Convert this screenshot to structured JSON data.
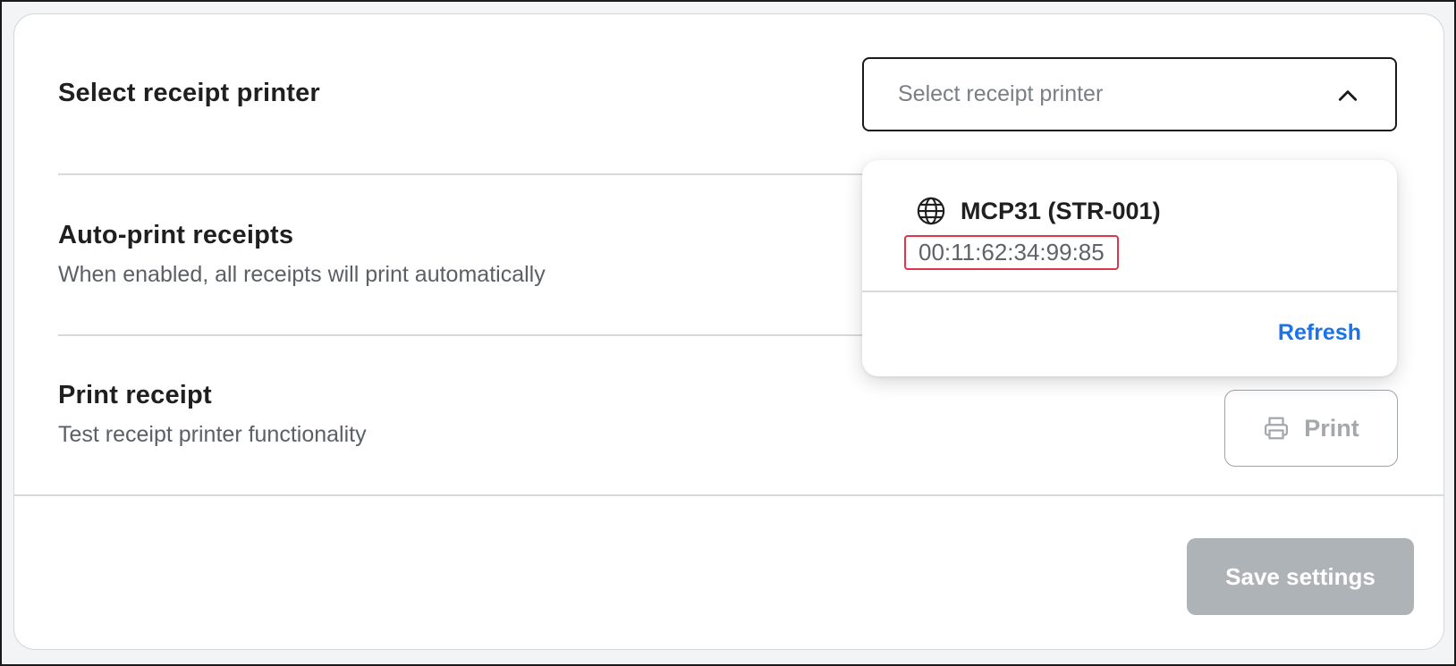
{
  "printer_row": {
    "title": "Select receipt printer",
    "select_placeholder": "Select receipt printer"
  },
  "dropdown": {
    "options": [
      {
        "name": "MCP31 (STR-001)",
        "mac": "00:11:62:34:99:85",
        "icon": "globe-icon"
      }
    ],
    "refresh_label": "Refresh"
  },
  "auto_print_row": {
    "title": "Auto-print receipts",
    "description": "When enabled, all receipts will print automatically"
  },
  "print_row": {
    "title": "Print receipt",
    "description": "Test receipt printer functionality",
    "button_label": "Print",
    "button_icon": "printer-icon"
  },
  "footer": {
    "save_label": "Save settings"
  },
  "colors": {
    "accent_link": "#1a73e8",
    "highlight_border": "#e0344a",
    "disabled_button": "#aeb3b7"
  }
}
